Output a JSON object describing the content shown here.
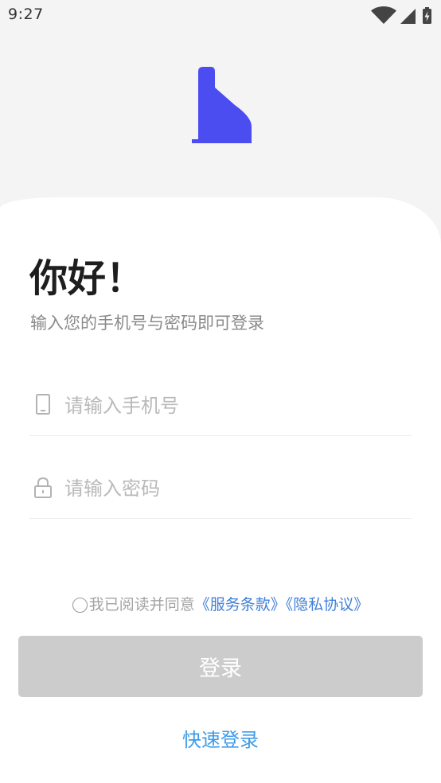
{
  "status_bar": {
    "time": "9:27",
    "icons": [
      "wifi-icon",
      "cellular-signal-icon",
      "battery-charging-icon"
    ]
  },
  "logo": {
    "icon": "house-logo-icon",
    "color": "#4b4df0"
  },
  "greeting": {
    "title": "你好！",
    "subtitle": "输入您的手机号与密码即可登录"
  },
  "form": {
    "phone": {
      "placeholder": "请输入手机号",
      "value": "",
      "icon": "phone-icon"
    },
    "password": {
      "placeholder": "请输入密码",
      "value": "",
      "icon": "lock-icon"
    }
  },
  "agreement": {
    "checked": false,
    "text": "我已阅读并同意",
    "terms_link": "《服务条款》",
    "privacy_link": "《隐私协议》"
  },
  "login_button": {
    "label": "登录",
    "enabled": false
  },
  "quick_login": {
    "label": "快速登录"
  },
  "colors": {
    "background": "#f4f4f4",
    "card": "#ffffff",
    "brand": "#4b4df0",
    "link": "#3f7fd8",
    "quick_link": "#3d9be8",
    "button_disabled": "#cccccc"
  }
}
